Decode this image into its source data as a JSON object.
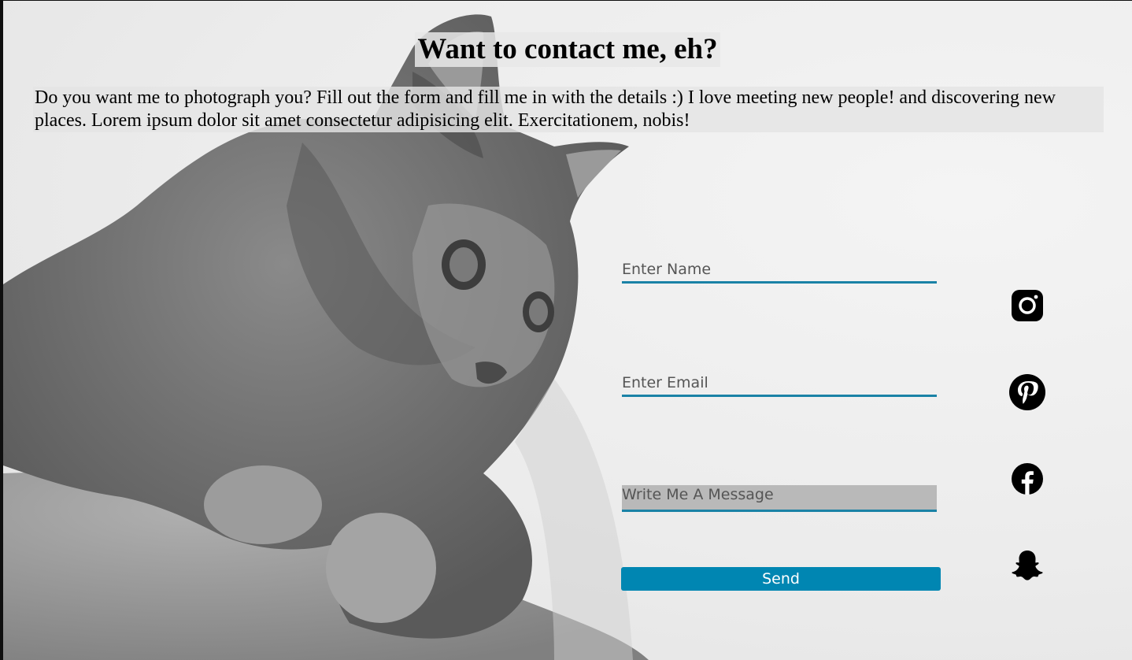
{
  "header": {
    "title": "Want to contact me, eh?"
  },
  "intro": {
    "text": "Do you want me to photograph you? Fill out the form and fill me in with the details :) I love meeting new people! and discovering new places. Lorem ipsum dolor sit amet consectetur adipisicing elit. Exercitationem, nobis!"
  },
  "form": {
    "name_placeholder": "Enter Name",
    "email_placeholder": "Enter Email",
    "message_placeholder": "Write Me A Message",
    "send_label": "Send"
  },
  "socials": [
    {
      "icon": "instagram-icon"
    },
    {
      "icon": "pinterest-icon"
    },
    {
      "icon": "facebook-icon"
    },
    {
      "icon": "snapchat-icon"
    }
  ],
  "colors": {
    "accent": "#0086b2",
    "field_underline": "#1a82a6",
    "message_bg": "#b9b9b9",
    "icon": "#000000"
  }
}
